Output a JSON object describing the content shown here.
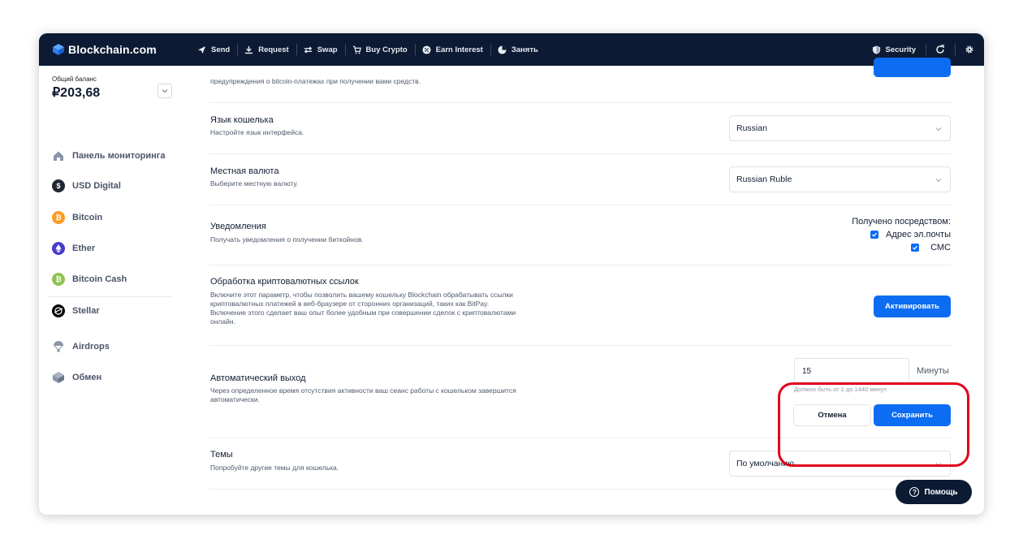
{
  "topbar": {
    "brand": "Blockchain.com",
    "nav": [
      {
        "label": "Send",
        "icon": "send-icon"
      },
      {
        "label": "Request",
        "icon": "download-icon"
      },
      {
        "label": "Swap",
        "icon": "swap-icon"
      },
      {
        "label": "Buy Crypto",
        "icon": "cart-icon"
      },
      {
        "label": "Earn Interest",
        "icon": "percent-icon"
      },
      {
        "label": "Занять",
        "icon": "pie-icon"
      }
    ],
    "security": "Security"
  },
  "sidebar": {
    "balance_label": "Общий баланс",
    "balance_value": "₽203,68",
    "items": [
      {
        "label": "Панель мониторинга",
        "icon": "home-icon"
      },
      {
        "label": "USD Digital",
        "icon": "usd-digital-icon",
        "color": "#1f2633"
      },
      {
        "label": "Bitcoin",
        "icon": "bitcoin-icon",
        "color": "#ff9b22"
      },
      {
        "label": "Ether",
        "icon": "ether-icon",
        "color": "#473bcb"
      },
      {
        "label": "Bitcoin Cash",
        "icon": "bitcoin-cash-icon",
        "color": "#8dc351"
      },
      {
        "label": "Stellar",
        "icon": "stellar-icon",
        "color": "#000000"
      },
      {
        "label": "Airdrops",
        "icon": "parachute-icon"
      },
      {
        "label": "Обмен",
        "icon": "exchange-icon"
      }
    ]
  },
  "settings": {
    "top_desc": "предупреждения о bitcoin-платежах при получении вами средств.",
    "language": {
      "title": "Язык кошелька",
      "desc": "Настройте язык интерфейса.",
      "value": "Russian"
    },
    "currency": {
      "title": "Местная валюта",
      "desc": "Выберите местную валюту.",
      "value": "Russian Ruble"
    },
    "notifications": {
      "title": "Уведомления",
      "desc": "Получать уведомления о получении биткойнов.",
      "received_label": "Получено посредством:",
      "options": [
        "Адрес эл.почты",
        "СМС"
      ]
    },
    "crypto_links": {
      "title": "Обработка криптовалютных ссылок",
      "desc_lines": [
        "Включите этот параметр, чтобы позволить вашему кошельку Blockchain обрабатывать ссылки",
        "криптовалютных платежей в веб-браузере от сторонних организаций, таких как BitPay.",
        "Включение этого сделает ваш опыт более удобным при совершении сделок с криптовалютами",
        "онлайн."
      ],
      "button": "Активировать"
    },
    "auto_logout": {
      "title": "Автоматический выход",
      "desc_lines": [
        "Через определенное время отсутствия активности ваш сеанс работы с кошельком завершится",
        "автоматически."
      ],
      "value": "15",
      "unit": "Минуты",
      "hint": "Должно быть от 1 до 1440 минут.",
      "cancel": "Отмена",
      "save": "Сохранить"
    },
    "themes": {
      "title": "Темы",
      "desc": "Попробуйте другие темы для кошелька.",
      "value": "По умолчанию"
    }
  },
  "help": {
    "label": "Помощь"
  },
  "colors": {
    "accent": "#0c6cf2",
    "topbar": "#0c1b33",
    "highlight": "#e0001b"
  }
}
